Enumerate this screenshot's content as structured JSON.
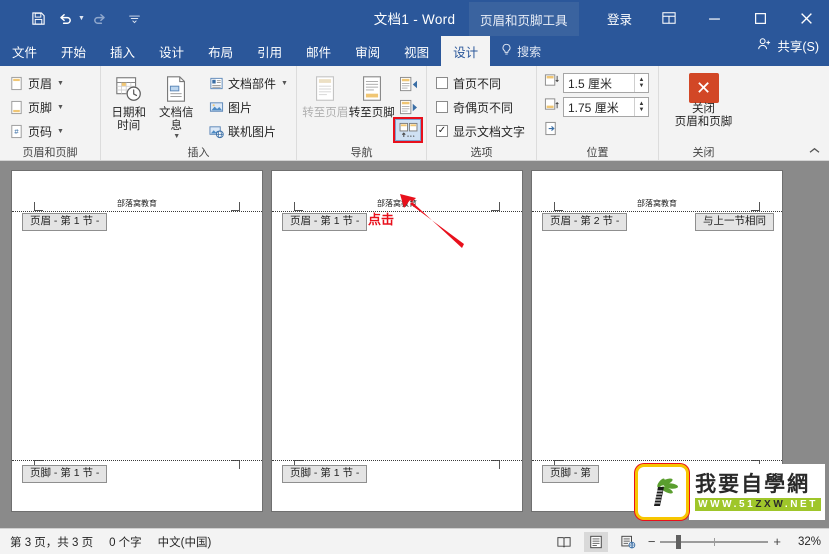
{
  "titlebar": {
    "quick_access": [
      {
        "name": "save-icon",
        "label": "保存"
      },
      {
        "name": "undo-icon",
        "label": "撤消"
      },
      {
        "name": "redo-icon",
        "label": "恢复"
      },
      {
        "name": "customize-qat-icon",
        "label": "自定义快速访问工具栏"
      }
    ],
    "document_title": "文档1  -  Word",
    "contextual_tab": "页眉和页脚工具",
    "signin": "登录",
    "ribbon_display_options": "功能区显示选项",
    "minimize": "最小化",
    "maximize": "最大化",
    "close": "关闭"
  },
  "tabs": [
    {
      "label": "文件",
      "active": false
    },
    {
      "label": "开始",
      "active": false
    },
    {
      "label": "插入",
      "active": false
    },
    {
      "label": "设计",
      "active": false
    },
    {
      "label": "布局",
      "active": false
    },
    {
      "label": "引用",
      "active": false
    },
    {
      "label": "邮件",
      "active": false
    },
    {
      "label": "审阅",
      "active": false
    },
    {
      "label": "视图",
      "active": false
    },
    {
      "label": "设计",
      "active": true
    }
  ],
  "tell_me": "搜索",
  "share": "共享(S)",
  "ribbon": {
    "groups": [
      {
        "label": "页眉和页脚",
        "items": [
          {
            "label": "页眉",
            "icon": "header-icon",
            "dropdown": true
          },
          {
            "label": "页脚",
            "icon": "footer-icon",
            "dropdown": true
          },
          {
            "label": "页码",
            "icon": "page-number-icon",
            "dropdown": true
          }
        ]
      },
      {
        "label": "插入",
        "big": [
          {
            "label": "日期和时间",
            "icon": "date-time-icon"
          },
          {
            "label": "文档信息",
            "icon": "doc-info-icon",
            "dropdown": true
          }
        ],
        "items": [
          {
            "label": "文档部件",
            "icon": "quick-parts-icon",
            "dropdown": true
          },
          {
            "label": "图片",
            "icon": "picture-icon",
            "dropdown": false
          },
          {
            "label": "联机图片",
            "icon": "online-picture-icon",
            "dropdown": false
          }
        ]
      },
      {
        "label": "导航",
        "big": [
          {
            "label": "转至页眉",
            "icon": "goto-header-icon",
            "disabled": true
          },
          {
            "label": "转至页脚",
            "icon": "goto-footer-icon",
            "disabled": false
          }
        ],
        "small": [
          {
            "name": "previous-section-button",
            "tooltip": "上一节"
          },
          {
            "name": "next-section-button",
            "tooltip": "下一节"
          },
          {
            "name": "link-to-previous-button",
            "tooltip": "链接到前一条页眉",
            "highlighted": true
          }
        ]
      },
      {
        "label": "选项",
        "checkboxes": [
          {
            "label": "首页不同",
            "checked": false
          },
          {
            "label": "奇偶页不同",
            "checked": false
          },
          {
            "label": "显示文档文字",
            "checked": true
          }
        ]
      },
      {
        "label": "位置",
        "spinners": [
          {
            "icon": "header-from-top-icon",
            "value": "1.5 厘米"
          },
          {
            "icon": "footer-from-bottom-icon",
            "value": "1.75 厘米"
          }
        ],
        "extra": {
          "label": "插入对齐方式选项卡",
          "icon": "insert-alignment-tab-icon"
        }
      },
      {
        "label": "关闭",
        "close_button": {
          "line1": "关闭",
          "line2": "页眉和页脚",
          "icon": "close-header-footer-icon"
        }
      }
    ],
    "collapse_icon": "collapse-ribbon-icon"
  },
  "annotation": {
    "text": "点击",
    "color": "#e8101c"
  },
  "document": {
    "pages": [
      {
        "header_text": "部落窝教育",
        "header_tag": "页眉 - 第 1 节 -",
        "footer_tag": "页脚 - 第 1 节 -",
        "same_as_previous": null
      },
      {
        "header_text": "部落窝教育",
        "header_tag": "页眉 - 第 1 节 -",
        "footer_tag": "页脚 - 第 1 节 -",
        "same_as_previous": null
      },
      {
        "header_text": "部落窝教育",
        "header_tag": "页眉 - 第 2 节 -",
        "footer_tag": "页脚 - 第",
        "same_as_previous": "与上一节相同"
      }
    ]
  },
  "watermark": {
    "title": "我要自學網",
    "url_prefix": "WWW.51",
    "url_mid": "ZXW",
    "url_suffix": ".NET"
  },
  "statusbar": {
    "page_info": "第 3 页，共 3 页",
    "word_count": "0 个字",
    "language": "中文(中国)",
    "views": [
      {
        "name": "read-mode-view-button",
        "active": false
      },
      {
        "name": "print-layout-view-button",
        "active": true
      },
      {
        "name": "web-layout-view-button",
        "active": false
      }
    ],
    "zoom_out": "−",
    "zoom_in": "+",
    "zoom_level": "32%"
  }
}
